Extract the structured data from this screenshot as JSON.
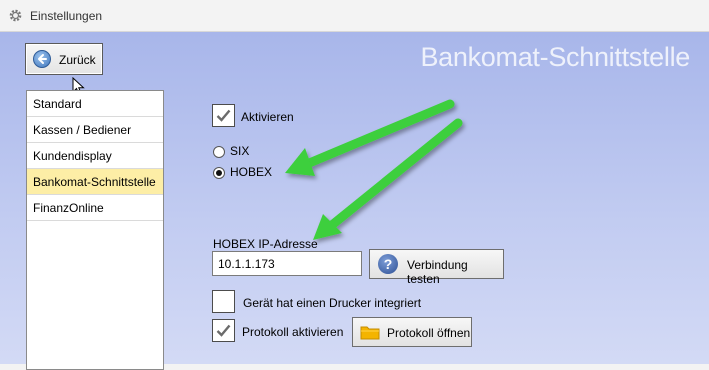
{
  "window": {
    "title": "Einstellungen",
    "icon": "gear-icon"
  },
  "page": {
    "heading": "Bankomat-Schnittstelle"
  },
  "back_button": {
    "label": "Zurück",
    "icon": "arrow-left-icon"
  },
  "nav": {
    "items": [
      {
        "label": "Standard",
        "selected": false
      },
      {
        "label": "Kassen / Bediener",
        "selected": false
      },
      {
        "label": "Kundendisplay",
        "selected": false
      },
      {
        "label": "Bankomat-Schnittstelle",
        "selected": true
      },
      {
        "label": "FinanzOnline",
        "selected": false
      }
    ],
    "selected_color": "#fdeea6"
  },
  "settings": {
    "activate": {
      "label": "Aktivieren",
      "checked": true
    },
    "provider": {
      "options": [
        {
          "label": "SIX",
          "selected": false
        },
        {
          "label": "HOBEX",
          "selected": true
        }
      ]
    },
    "ip": {
      "label": "HOBEX IP-Adresse",
      "value": "10.1.1.173"
    },
    "test_button": {
      "label": "Verbindung testen",
      "icon": "question-icon"
    },
    "printer": {
      "label": "Gerät hat einen Drucker integriert",
      "checked": false
    },
    "log": {
      "label": "Protokoll aktivieren",
      "checked": true
    },
    "open_log_button": {
      "label": "Protokoll öffnen",
      "icon": "folder-icon"
    }
  },
  "annotation": {
    "arrow_color": "#3ccf3c"
  }
}
